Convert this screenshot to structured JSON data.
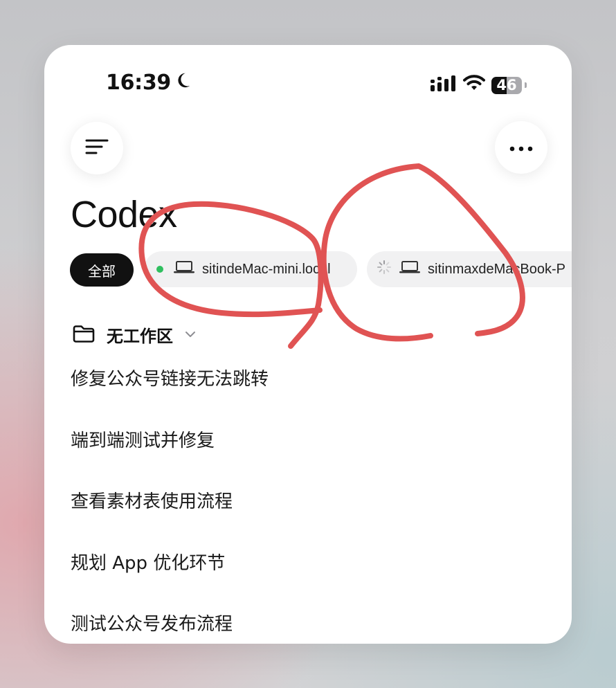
{
  "status_bar": {
    "time": "16:39",
    "battery": "46",
    "icons": [
      "moon-icon",
      "signal-icon",
      "wifi-icon",
      "battery-icon"
    ]
  },
  "header": {
    "menu_icon": "menu-icon",
    "more_icon": "more-horizontal-icon",
    "title": "Codex"
  },
  "filters": {
    "all_label": "全部",
    "devices": [
      {
        "name": "sitindeMac-mini.local",
        "status": "online",
        "status_color": "#2fbf5f",
        "icon": "laptop-icon"
      },
      {
        "name": "sitinmaxdeMacBook-P",
        "status": "connecting",
        "icon": "laptop-icon"
      }
    ]
  },
  "workspace": {
    "label": "无工作区",
    "icon": "folder-icon",
    "chevron": "chevron-down-icon"
  },
  "tasks": [
    "修复公众号链接无法跳转",
    "端到端测试并修复",
    "查看素材表使用流程",
    "规划 App 优化环节",
    "测试公众号发布流程"
  ],
  "annotation_color": "#e05353"
}
